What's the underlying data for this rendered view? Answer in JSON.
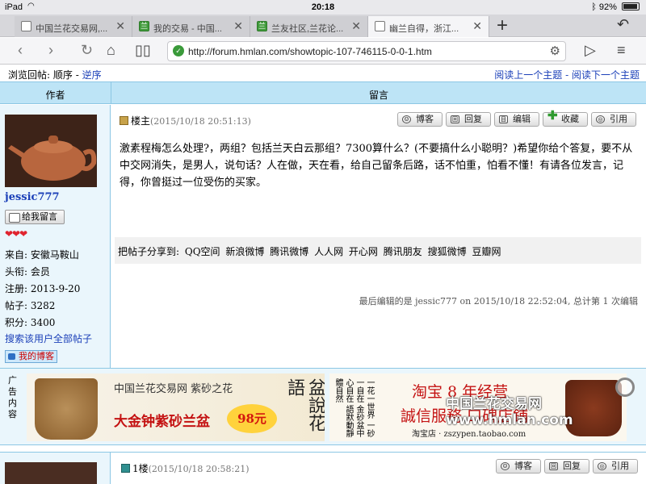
{
  "status": {
    "device": "iPad",
    "time": "20:18",
    "battery": "92%",
    "battery_level": 0.92
  },
  "tabs": [
    {
      "title": "中国兰花交易网,...",
      "active": false
    },
    {
      "title": "我的交易 - 中国...",
      "active": false
    },
    {
      "title": "兰友社区,兰花论...",
      "active": false
    },
    {
      "title": "幽兰自得，浙江...",
      "active": true
    }
  ],
  "toolbar": {
    "url": "http://forum.hmlan.com/showtopic-107-746115-0-0-1.htm"
  },
  "topline": {
    "browse_label": "浏览回帖:",
    "order": "顺序",
    "dash": " - ",
    "reverse": "逆序",
    "prev_topic": "阅读上一个主题",
    "next_topic": "阅读下一个主题"
  },
  "header": {
    "author": "作者",
    "message": "留言"
  },
  "author": {
    "username": "jessic777",
    "leave_msg": "给我留言",
    "hearts": "❤❤❤",
    "info": [
      {
        "label": "来自:",
        "value": "安徽马鞍山"
      },
      {
        "label": "头衔:",
        "value": "会员"
      },
      {
        "label": "注册:",
        "value": "2013-9-20"
      },
      {
        "label": "帖子:",
        "value": "3282"
      },
      {
        "label": "积分:",
        "value": "3400"
      }
    ],
    "search_posts": "搜索该用户全部帖子",
    "my_blog": "我的博客"
  },
  "post": {
    "floor": "楼主",
    "date": "(2015/10/18 20:51:13)",
    "buttons": {
      "blog": "博客",
      "reply": "回复",
      "edit": "编辑",
      "favorite": "收藏",
      "quote": "引用"
    },
    "content": "激素程梅怎么处理?，两组？包括兰天白云那组？7300算什么？(不要搞什么小聪明？)希望你给个答复，要不从中交网消失，是男人，说句话？人在做，天在看，给自己留条后路，话不怕重，怕看不懂！有请各位发言，记得，你曾挺过一位受伤的买家。",
    "share_label": "把帖子分享到:",
    "share_targets": [
      "QQ空间",
      "新浪微博",
      "腾讯微博",
      "人人网",
      "开心网",
      "腾讯朋友",
      "搜狐微博",
      "豆瓣网"
    ],
    "edited": "最后编辑的是 jessic777 on 2015/10/18 22:52:04, 总计第 1 次编辑"
  },
  "ads": {
    "label": "广告内容",
    "ad1": {
      "line1": "中国兰花交易网  紫砂之花",
      "line2": "大金钟紫砂兰盆",
      "price": "98元",
      "calligraphy": "盆說花語"
    },
    "ad2": {
      "poem": "一花一世界 一砂一自在 金砂盆中心自在 語默動靜體自然",
      "slogan1": "淘宝 8 年经营",
      "slogan2": "誠信服務 口碑店鋪",
      "shop": "淘宝店 · zszypen.taobao.com"
    }
  },
  "post2": {
    "floor": "1楼",
    "date": "(2015/10/18 20:58:21)",
    "blog": "博客",
    "reply": "回复",
    "quote": "引用"
  },
  "watermark": "中国兰花交易网 www.hmlan.com"
}
